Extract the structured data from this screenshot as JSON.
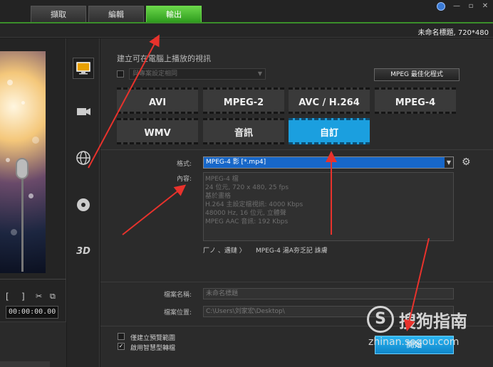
{
  "tabs": [
    {
      "label": "擷取",
      "active": false
    },
    {
      "label": "編輯",
      "active": false
    },
    {
      "label": "輸出",
      "active": true
    }
  ],
  "window": {
    "minimize": "—",
    "restore": "▫",
    "close": "✕"
  },
  "project_info": "未命名標題, 720*480",
  "preview": {
    "mark_in": "[",
    "mark_out": "]",
    "timecode": "00:00:00.00"
  },
  "side_nav": [
    {
      "icon": "monitor-icon",
      "active": true
    },
    {
      "icon": "camcorder-icon",
      "active": false
    },
    {
      "icon": "globe-icon",
      "active": false
    },
    {
      "icon": "disc-icon",
      "active": false
    },
    {
      "icon": "3d-icon",
      "label": "3D",
      "active": false
    }
  ],
  "main": {
    "section_title": "建立可在電腦上播放的視訊",
    "preset_select": "與專案設定相同",
    "mpeg_optimizer_label": "MPEG 最佳化程式",
    "format_buttons": [
      {
        "label": "AVI",
        "active": false
      },
      {
        "label": "MPEG-2",
        "active": false
      },
      {
        "label": "AVC / H.264",
        "active": false
      },
      {
        "label": "MPEG-4",
        "active": false
      },
      {
        "label": "WMV",
        "active": false
      },
      {
        "label": "音訊",
        "active": false
      },
      {
        "label": "自訂",
        "active": true
      }
    ],
    "format_label": "格式:",
    "format_value": "MPEG-4 影 [*.mp4]",
    "content_label": "內容:",
    "content_lines": [
      "MPEG-4 檔",
      "24 位元, 720 x 480, 25 fps",
      "基於畫格",
      "H.264 主設定檔視訊: 4000 Kbps",
      "48000 Hz, 16 位元, 立體聲",
      "MPEG AAC 音訊: 192 Kbps"
    ],
    "properties_left": "厂ノ 、遇鏈 〉",
    "properties_right": "MPEG-4 湯A夯乏記  誅膚",
    "filename_label": "檔案名稱:",
    "filename_value": "未命名標題",
    "location_label": "檔案位置:",
    "location_value": "C:\\Users\\刘家宏\\Desktop\\",
    "checkbox1_label": "僅建立預覽範圍",
    "checkbox2_label": "啟用智慧型轉檔",
    "checkbox1_checked": false,
    "checkbox2_checked": true,
    "checkmark": "✓",
    "start_label": "開始"
  },
  "watermark": {
    "logo_letter": "S",
    "text": "搜狗指南",
    "url": "zhinan.sogou.com"
  },
  "colors": {
    "accent_green": "#2f9d1e",
    "accent_blue": "#1b9fdf",
    "annotation_red": "#e8322c"
  }
}
